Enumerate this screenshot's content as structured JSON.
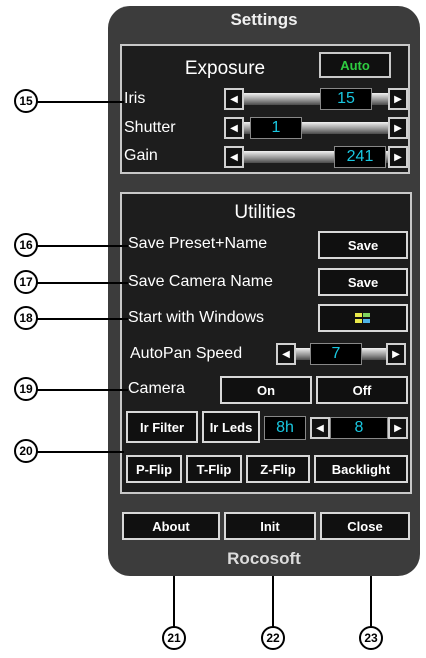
{
  "window": {
    "title": "Settings",
    "footer": "Rocosoft"
  },
  "exposure": {
    "heading": "Exposure",
    "auto_label": "Auto",
    "iris": {
      "label": "Iris",
      "value": "15"
    },
    "shutter": {
      "label": "Shutter",
      "value": "1"
    },
    "gain": {
      "label": "Gain",
      "value": "241"
    }
  },
  "utilities": {
    "heading": "Utilities",
    "save_preset_label": "Save Preset+Name",
    "save_preset_button": "Save",
    "save_camera_label": "Save Camera Name",
    "save_camera_button": "Save",
    "start_windows_label": "Start with Windows",
    "autopan_label": "AutoPan Speed",
    "autopan_value": "7",
    "camera_label": "Camera",
    "camera_on": "On",
    "camera_off": "Off",
    "ir_filter": "Ir Filter",
    "ir_leds": "Ir Leds",
    "ir_time": "8h",
    "ir_value": "8",
    "pflip": "P-Flip",
    "tflip": "T-Flip",
    "zflip": "Z-Flip",
    "backlight": "Backlight"
  },
  "bottom": {
    "about": "About",
    "init": "Init",
    "close": "Close"
  },
  "callouts": [
    "15",
    "16",
    "17",
    "18",
    "19",
    "20",
    "21",
    "22",
    "23"
  ],
  "colors": {
    "panel": "#3c3c3c",
    "value_text": "#19c7e0",
    "auto_text": "#2ecc40"
  }
}
